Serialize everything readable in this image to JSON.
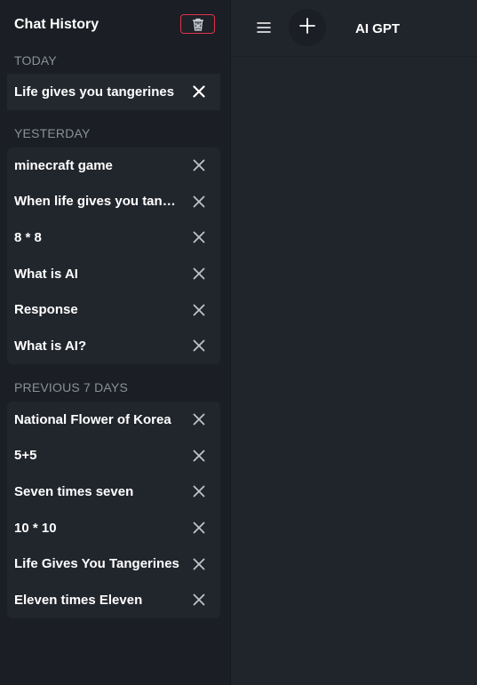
{
  "sidebar": {
    "title": "Chat History",
    "clear_icon": "trash-bin-icon",
    "sections": [
      {
        "label": "TODAY",
        "items": [
          {
            "label": "Life gives you tangerines",
            "active": true
          }
        ]
      },
      {
        "label": "YESTERDAY",
        "items": [
          {
            "label": "minecraft game"
          },
          {
            "label": "When life gives you tangerines"
          },
          {
            "label": "8 * 8"
          },
          {
            "label": "What is AI"
          },
          {
            "label": "Response"
          },
          {
            "label": "What is AI?"
          }
        ]
      },
      {
        "label": "PREVIOUS 7 DAYS",
        "items": [
          {
            "label": "National Flower of Korea"
          },
          {
            "label": "5+5"
          },
          {
            "label": "Seven times seven"
          },
          {
            "label": "10 * 10"
          },
          {
            "label": "Life Gives You Tangerines"
          },
          {
            "label": "Eleven times Eleven"
          }
        ]
      }
    ]
  },
  "topbar": {
    "title": "AI GPT",
    "menu_icon": "hamburger-menu-icon",
    "new_chat_icon": "plus-icon"
  },
  "colors": {
    "sidebar_bg": "#1b1f25",
    "main_bg": "#20242b",
    "accent_red": "#e0314b",
    "muted_text": "#8a9099"
  }
}
